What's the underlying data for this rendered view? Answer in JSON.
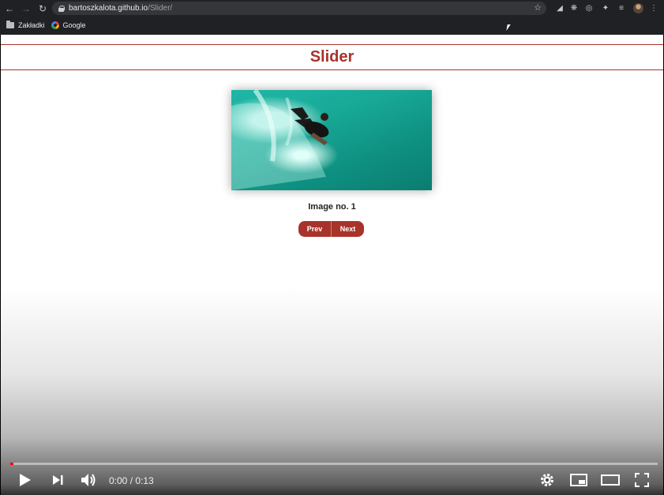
{
  "browser": {
    "url_host": "bartoszkalota.github.io",
    "url_path": "/Slider/",
    "bookmarks": [
      {
        "label": "Zakładki",
        "icon": "folder-icon"
      },
      {
        "label": "Google",
        "icon": "google-icon"
      }
    ]
  },
  "page": {
    "title": "Slider",
    "caption": "Image no. 1",
    "prev_label": "Prev",
    "next_label": "Next"
  },
  "player": {
    "time": "0:00 / 0:13",
    "progress": 0.005
  },
  "colors": {
    "accent": "#a8332b",
    "progress": "#ff0000"
  }
}
